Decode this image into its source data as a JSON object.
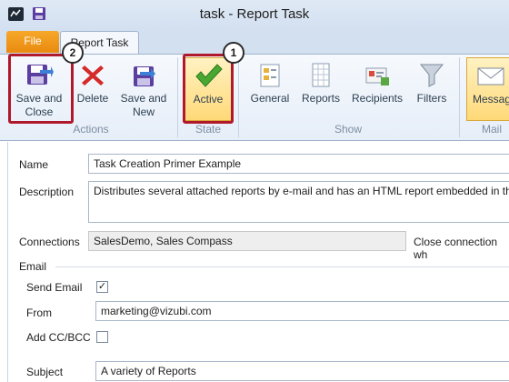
{
  "window": {
    "title": "task - Report Task"
  },
  "tabs": {
    "file": "File",
    "active": "Report Task"
  },
  "ribbon": {
    "actions": {
      "save_and_close": [
        "Save and",
        "Close"
      ],
      "delete": "Delete",
      "save_and_new": [
        "Save and",
        "New"
      ],
      "label": "Actions"
    },
    "state": {
      "active": "Active",
      "label": "State"
    },
    "show": {
      "general": "General",
      "reports": "Reports",
      "recipients": "Recipients",
      "filters": "Filters",
      "label": "Show"
    },
    "mail": {
      "message": "Messag",
      "label": "Mail"
    }
  },
  "callouts": {
    "one": "1",
    "two": "2"
  },
  "form": {
    "name_label": "Name",
    "name_value": "Task Creation Primer Example",
    "description_label": "Description",
    "description_value": "Distributes several attached reports by e-mail and has an HTML report embedded in the",
    "connections_label": "Connections",
    "connections_value": "SalesDemo, Sales Compass",
    "close_connection_label": "Close connection wh",
    "email_section": "Email",
    "send_email_label": "Send Email",
    "send_email_checked": "✓",
    "from_label": "From",
    "from_value": "marketing@vizubi.com",
    "add_cc_label": "Add CC/BCC",
    "subject_label": "Subject",
    "subject_value": "A variety of Reports"
  },
  "colors": {
    "accent": "#b0192c",
    "file_tab": "#e98a10",
    "selected": "#ffd978"
  }
}
